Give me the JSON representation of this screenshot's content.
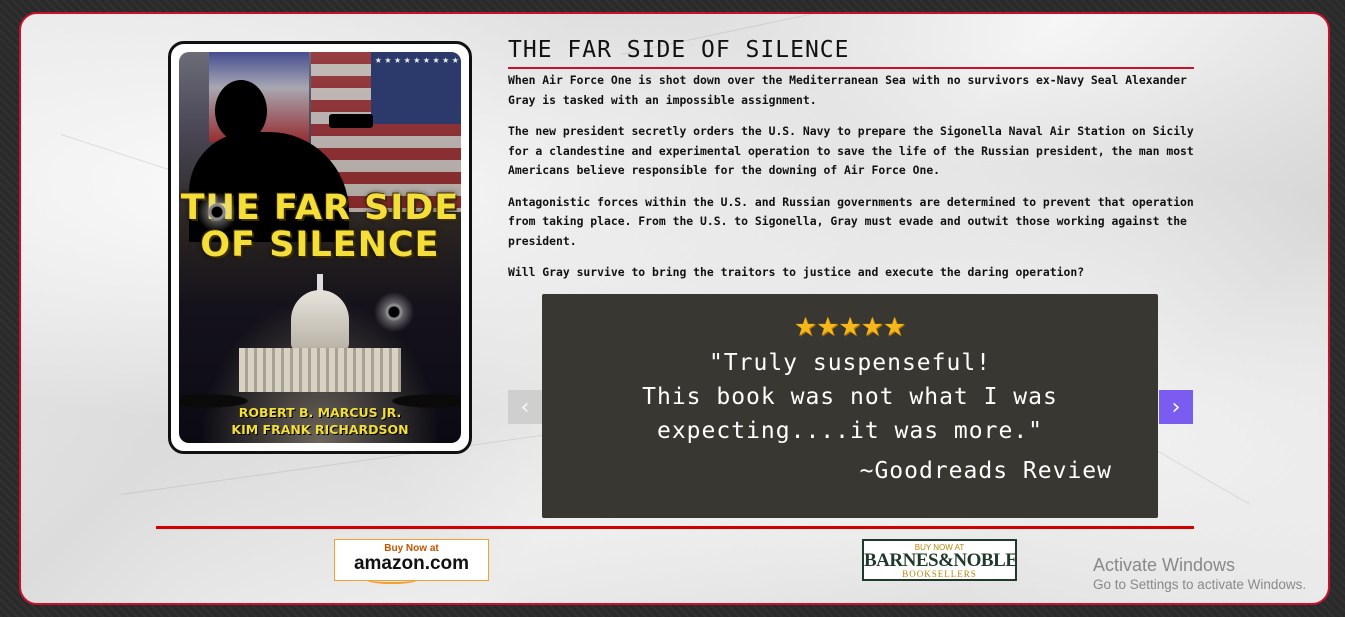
{
  "book": {
    "cover_title": "THE FAR SIDE OF SILENCE",
    "cover_authors": [
      "ROBERT B. MARCUS JR.",
      "KIM FRANK RICHARDSON"
    ],
    "title": "THE FAR SIDE OF SILENCE",
    "description": [
      "When Air Force One is shot down over the Mediterranean Sea with no survivors ex-Navy Seal Alexander Gray is tasked with an impossible assignment.",
      "The new president secretly orders the U.S. Navy to prepare the Sigonella Naval Air Station on Sicily for a clandestine and experimental operation to save the life of the Russian president, the man most Americans believe responsible for the downing of Air Force One.",
      "Antagonistic forces within the U.S. and Russian governments are determined to prevent that operation from taking place. From the U.S. to Sigonella, Gray must evade and outwit those working against the president.",
      "Will Gray survive to bring the traitors to justice and execute the daring operation?"
    ]
  },
  "review": {
    "stars": "★★★★★",
    "rating": 5,
    "text": "\"Truly suspenseful!\nThis book was not what I was\nexpecting....it was more.\"",
    "source": "~Goodreads Review",
    "prev_label": "‹",
    "next_label": "›"
  },
  "buttons": {
    "amazon_small": "Buy Now at",
    "amazon_big": "amazon.com",
    "bn_small": "BUY NOW AT",
    "bn_big": "BARNES&NOBLE",
    "bn_sub": "BOOKSELLERS"
  },
  "watermark": {
    "line1": "Activate Windows",
    "line2": "Go to Settings to activate Windows."
  },
  "colors": {
    "accent_red": "#c8102e",
    "review_bg": "#383732",
    "star": "#f5b81c",
    "next_arrow_bg": "#7a5cf0"
  }
}
